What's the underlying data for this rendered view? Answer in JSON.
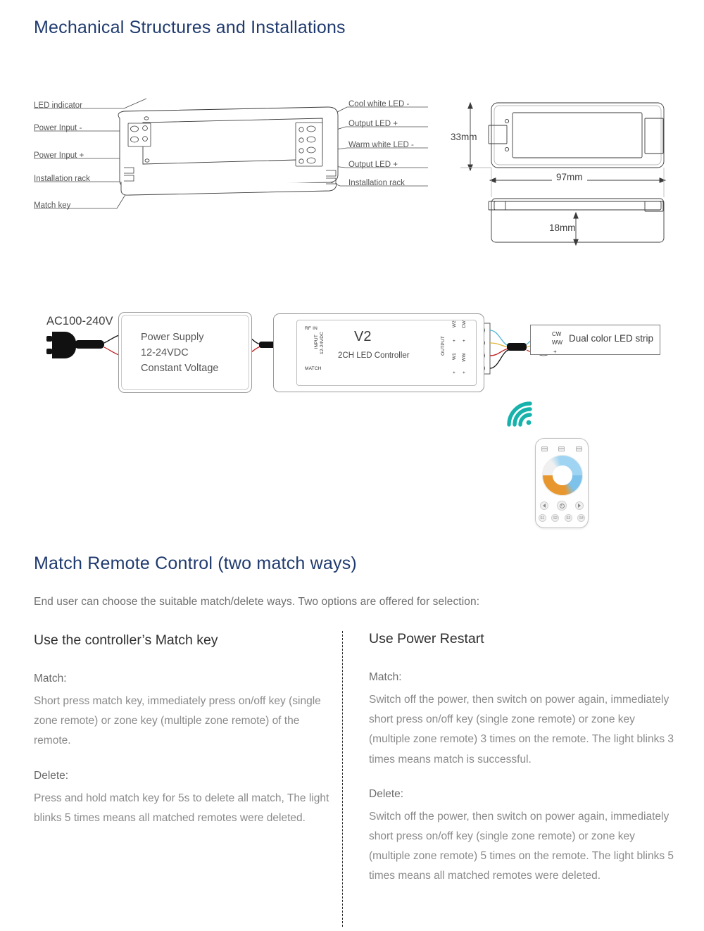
{
  "headings": {
    "mechanical": "Mechanical Structures and Installations",
    "match": "Match Remote Control (two match ways)"
  },
  "intro": "End user can choose the suitable match/delete ways. Two options are offered for selection:",
  "exploded_diagram": {
    "left_callouts": [
      "LED indicator",
      "Power Input -",
      "Power Input +",
      "Installation rack",
      "Match key"
    ],
    "right_callouts": [
      "Cool white LED -",
      "Output LED +",
      "Warm white LED -",
      "Output LED +",
      "Installation rack"
    ]
  },
  "dimensions": {
    "height": "33mm",
    "length": "97mm",
    "thickness": "18mm"
  },
  "wiring": {
    "ac_label": "AC100-240V",
    "power_supply": {
      "line1": "Power Supply",
      "line2": "12-24VDC",
      "line3": "Constant Voltage"
    },
    "controller": {
      "model": "V2",
      "subtitle": "2CH LED Controller",
      "rf_label": "RF IN",
      "match_label": "MATCH",
      "input_label": "INPUT",
      "input_voltage": "12-24VDC",
      "input_minus": "-",
      "input_plus": "+",
      "output_label": "OUTPUT",
      "output_terminals": [
        "W2",
        "CW",
        "W1",
        "WW"
      ],
      "output_plus": "+"
    },
    "led_strip": {
      "name": "Dual color LED strip",
      "pins": [
        "CW",
        "WW",
        "+"
      ]
    }
  },
  "remote": {
    "icon": "wifi-signal-icon",
    "zone_keys": [
      "zone-1",
      "zone-2",
      "zone-3"
    ],
    "bottom_keys": [
      "S1",
      "S2",
      "S3",
      "S4"
    ],
    "nav_keys": [
      "prev",
      "power",
      "next"
    ]
  },
  "columns": {
    "left": {
      "title": "Use the controller’s Match key",
      "match_label": "Match:",
      "match_body": "Short press match key, immediately press on/off key (single zone remote) or zone key (multiple zone remote) of the remote.",
      "delete_label": "Delete:",
      "delete_body": "Press and hold match key for 5s to delete all match, The light blinks 5 times means all matched remotes were deleted."
    },
    "right": {
      "title": "Use Power Restart",
      "match_label": "Match:",
      "match_body": "Switch off the power, then switch on power again, immediately short press on/off key (single zone remote) or zone key (multiple zone remote) 3 times on the remote. The light blinks 3 times means match is successful.",
      "delete_label": "Delete:",
      "delete_body": "Switch off the power, then switch on power again, immediately short press on/off key (single zone remote) or zone key (multiple zone remote) 5 times on the remote. The light blinks 5 times means all matched remotes were deleted."
    }
  },
  "colors": {
    "heading": "#1f3a6e",
    "body_text": "#8a8a8a",
    "wifi_teal": "#17b2ac",
    "wire_red": "#d01c1c",
    "wire_black": "#111111"
  }
}
